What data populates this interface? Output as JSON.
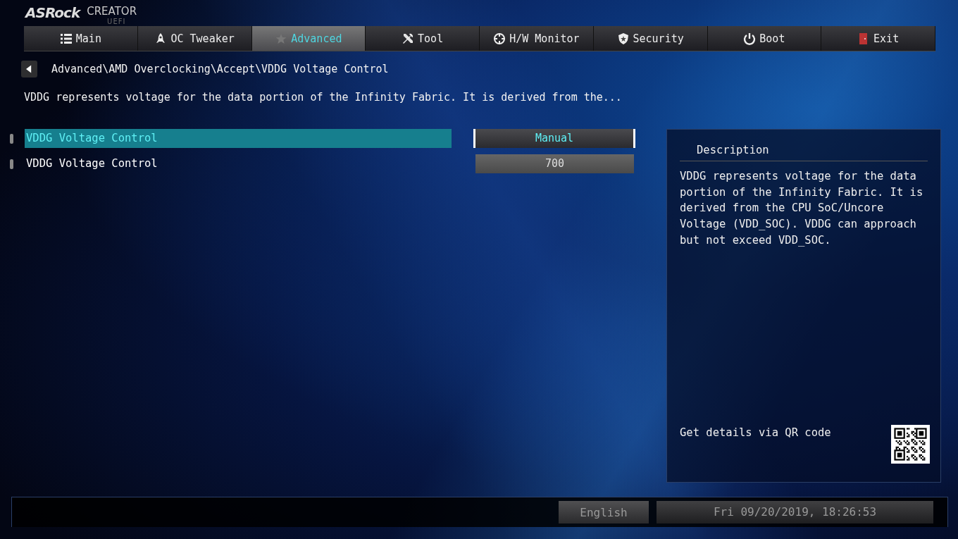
{
  "logo": {
    "brand": "ASRock",
    "edition": "CREATOR",
    "tag": "UEFI"
  },
  "tabs": [
    {
      "label": "Main",
      "kind": "list",
      "selected": false
    },
    {
      "label": "OC Tweaker",
      "kind": "rocket",
      "selected": false
    },
    {
      "label": "Advanced",
      "kind": "star",
      "selected": true
    },
    {
      "label": "Tool",
      "kind": "tools",
      "selected": false
    },
    {
      "label": "H/W Monitor",
      "kind": "crosshair",
      "selected": false
    },
    {
      "label": "Security",
      "kind": "badge",
      "selected": false
    },
    {
      "label": "Boot",
      "kind": "power",
      "selected": false
    },
    {
      "label": "Exit",
      "kind": "door",
      "selected": false
    }
  ],
  "breadcrumb": "Advanced\\AMD Overclocking\\Accept\\VDDG Voltage Control",
  "help_line": "VDDG represents voltage for the data portion of the Infinity Fabric. It is derived from the...",
  "settings": [
    {
      "label": "VDDG Voltage Control",
      "kind": "option",
      "value": "Manual",
      "selected": true
    },
    {
      "label": "VDDG Voltage Control",
      "kind": "number",
      "value": "700",
      "selected": false
    }
  ],
  "description": {
    "title": "Description",
    "text": "VDDG represents voltage for the data portion of the Infinity Fabric. It is derived from the CPU SoC/Uncore Voltage (VDD_SOC). VDDG can approach but not exceed VDD_SOC.",
    "qr_label": "Get details via QR code"
  },
  "status_bar": {
    "language": "English",
    "datetime": "Fri 09/20/2019, 18:26:53"
  }
}
